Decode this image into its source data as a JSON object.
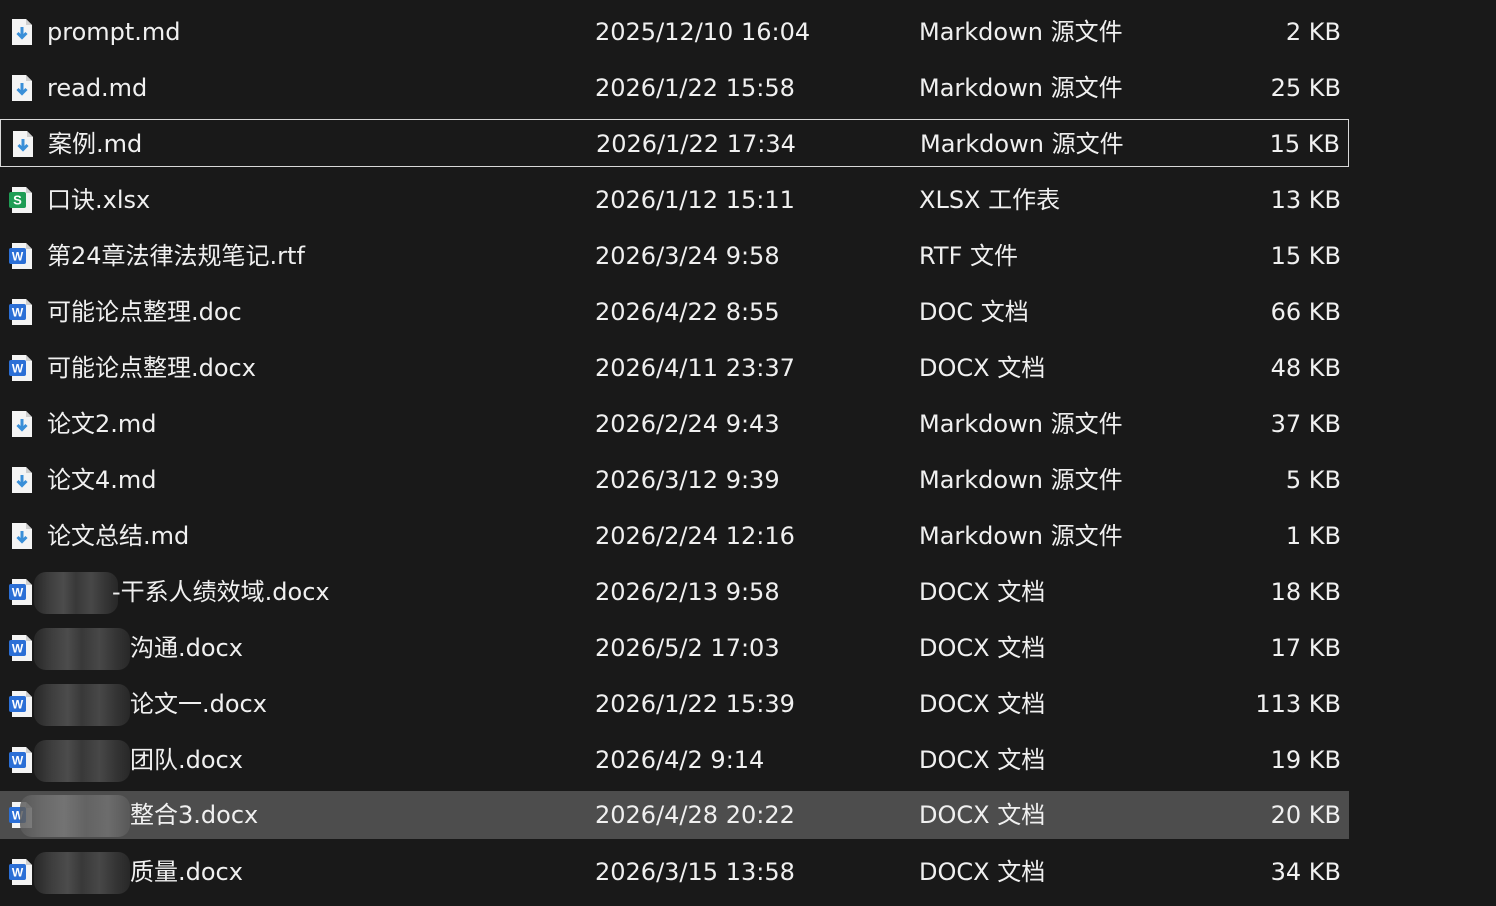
{
  "files": [
    {
      "name": "prompt.md",
      "date": "2025/12/10 16:04",
      "type": "Markdown 源文件",
      "size": "2 KB",
      "icon": "markdown-file-icon"
    },
    {
      "name": "read.md",
      "date": "2026/1/22 15:58",
      "type": "Markdown 源文件",
      "size": "25 KB",
      "icon": "markdown-file-icon"
    },
    {
      "name": "案例.md",
      "date": "2026/1/22 17:34",
      "type": "Markdown 源文件",
      "size": "15 KB",
      "icon": "markdown-file-icon"
    },
    {
      "name": "口诀.xlsx",
      "date": "2026/1/12 15:11",
      "type": "XLSX 工作表",
      "size": "13 KB",
      "icon": "spreadsheet-file-icon"
    },
    {
      "name": "第24章法律法规笔记.rtf",
      "date": "2026/3/24 9:58",
      "type": "RTF 文件",
      "size": "15 KB",
      "icon": "word-file-icon"
    },
    {
      "name": "可能论点整理.doc",
      "date": "2026/4/22 8:55",
      "type": "DOC 文档",
      "size": "66 KB",
      "icon": "word-file-icon"
    },
    {
      "name": "可能论点整理.docx",
      "date": "2026/4/11 23:37",
      "type": "DOCX 文档",
      "size": "48 KB",
      "icon": "word-file-icon"
    },
    {
      "name": "论文2.md",
      "date": "2026/2/24 9:43",
      "type": "Markdown 源文件",
      "size": "37 KB",
      "icon": "markdown-file-icon"
    },
    {
      "name": "论文4.md",
      "date": "2026/3/12 9:39",
      "type": "Markdown 源文件",
      "size": "5 KB",
      "icon": "markdown-file-icon"
    },
    {
      "name": "论文总结.md",
      "date": "2026/2/24 12:16",
      "type": "Markdown 源文件",
      "size": "1 KB",
      "icon": "markdown-file-icon"
    },
    {
      "name": "-干系人绩效域.docx",
      "date": "2026/2/13 9:58",
      "type": "DOCX 文档",
      "size": "18 KB",
      "icon": "word-file-icon"
    },
    {
      "name": "沟通.docx",
      "date": "2026/5/2 17:03",
      "type": "DOCX 文档",
      "size": "17 KB",
      "icon": "word-file-icon"
    },
    {
      "name": "论文一.docx",
      "date": "2026/1/22 15:39",
      "type": "DOCX 文档",
      "size": "113 KB",
      "icon": "word-file-icon"
    },
    {
      "name": "团队.docx",
      "date": "2026/4/2 9:14",
      "type": "DOCX 文档",
      "size": "19 KB",
      "icon": "word-file-icon"
    },
    {
      "name": "整合3.docx",
      "date": "2026/4/28 20:22",
      "type": "DOCX 文档",
      "size": "20 KB",
      "icon": "word-file-icon"
    },
    {
      "name": "质量.docx",
      "date": "2026/3/15 13:58",
      "type": "DOCX 文档",
      "size": "34 KB",
      "icon": "word-file-icon"
    }
  ],
  "colors": {
    "background": "#191919",
    "selected_row": "#4d4d4d",
    "focus_border": "#d8d8d8",
    "word_icon": "#2b6fd6",
    "excel_icon": "#1f9d55",
    "markdown_arrow": "#3a8fd8"
  }
}
